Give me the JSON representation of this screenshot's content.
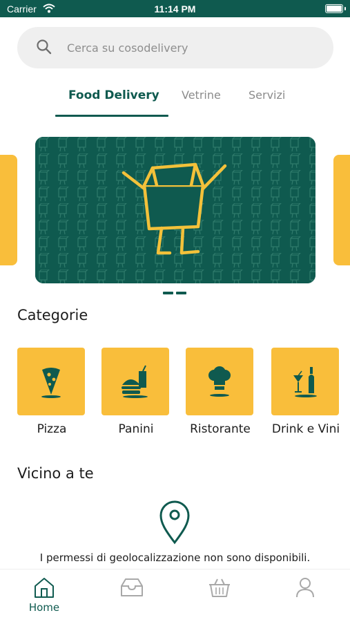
{
  "status_bar": {
    "carrier": "Carrier",
    "time": "11:14 PM"
  },
  "search": {
    "placeholder": "Cerca su cosodelivery",
    "value": ""
  },
  "tabs": [
    {
      "label": "Food Delivery",
      "active": true
    },
    {
      "label": "Vetrine",
      "active": false
    },
    {
      "label": "Servizi",
      "active": false
    }
  ],
  "carousel": {
    "pages": 2,
    "current_page": 1
  },
  "categories": {
    "title": "Categorie",
    "items": [
      {
        "label": "Pizza",
        "icon": "pizza-icon"
      },
      {
        "label": "Panini",
        "icon": "burger-icon"
      },
      {
        "label": "Ristorante",
        "icon": "chef-hat-icon"
      },
      {
        "label": "Drink e Vini",
        "icon": "wine-icon"
      }
    ]
  },
  "nearby": {
    "title": "Vicino a te",
    "message": "I permessi di geolocalizzazione non sono disponibili."
  },
  "tabbar": {
    "items": [
      {
        "label": "Home",
        "icon": "home-icon",
        "active": true
      },
      {
        "label": "",
        "icon": "inbox-icon",
        "active": false
      },
      {
        "label": "",
        "icon": "basket-icon",
        "active": false
      },
      {
        "label": "",
        "icon": "user-icon",
        "active": false
      }
    ]
  },
  "colors": {
    "primary": "#0f5a4f",
    "accent": "#f9be3b",
    "search_background": "#efefef",
    "inactive_icon": "#a8a8a8"
  }
}
